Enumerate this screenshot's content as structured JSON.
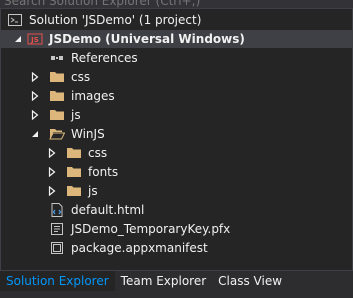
{
  "search": {
    "placeholder": "Search Solution Explorer (Ctrl+;)"
  },
  "tree": {
    "items": [
      {
        "label": "Solution 'JSDemo' (1 project)",
        "icon": "solution-icon"
      },
      {
        "label": "JSDemo (Universal Windows)",
        "icon": "js-project-icon",
        "expanded": true
      },
      {
        "label": "References",
        "icon": "references-icon"
      },
      {
        "label": "css",
        "icon": "folder-icon",
        "expanded": false
      },
      {
        "label": "images",
        "icon": "folder-icon",
        "expanded": false
      },
      {
        "label": "js",
        "icon": "folder-icon",
        "expanded": false
      },
      {
        "label": "WinJS",
        "icon": "folder-open-icon",
        "expanded": true
      },
      {
        "label": "css",
        "icon": "folder-icon",
        "expanded": false
      },
      {
        "label": "fonts",
        "icon": "folder-icon",
        "expanded": false
      },
      {
        "label": "js",
        "icon": "folder-icon",
        "expanded": false
      },
      {
        "label": "default.html",
        "icon": "html-file-icon"
      },
      {
        "label": "JSDemo_TemporaryKey.pfx",
        "icon": "certificate-file-icon"
      },
      {
        "label": "package.appxmanifest",
        "icon": "manifest-file-icon"
      }
    ]
  },
  "tabs": [
    {
      "label": "Solution Explorer",
      "active": true
    },
    {
      "label": "Team Explorer",
      "active": false
    },
    {
      "label": "Class View",
      "active": false
    }
  ],
  "colors": {
    "background": "#252526",
    "selected_row": "#3f3f46",
    "folder": "#dcb67a",
    "active_tab_text": "#0097fb"
  }
}
